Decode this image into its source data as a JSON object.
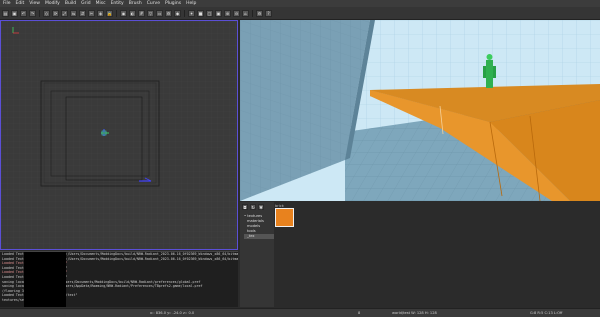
{
  "menu": [
    "File",
    "Edit",
    "View",
    "Modify",
    "Build",
    "Grid",
    "Misc",
    "Entity",
    "Brush",
    "Curve",
    "Plugins",
    "Help"
  ],
  "toolbar_icons": [
    "open-icon",
    "save-icon",
    "undo-icon",
    "redo-icon",
    "select-icon",
    "rotate-icon",
    "scale-icon",
    "flip-x-icon",
    "flip-y-icon",
    "clipper-icon",
    "csg-icon",
    "texture-lock-icon",
    "camera-icon",
    "patch-icon",
    "grid-icon",
    "filter-icon",
    "region-icon",
    "plugin-icon",
    "entity-icon",
    "light-icon",
    "brush-icon",
    "cube-icon",
    "hollow-icon",
    "merge-icon",
    "subtract-icon",
    "make-room-icon",
    "preferences-icon",
    "help-icon"
  ],
  "texture_browser": {
    "tree": [
      {
        "label": "• textures"
      },
      {
        "label": "materials"
      },
      {
        "label": "models"
      },
      {
        "label": "tools"
      },
      {
        "label": "_tex"
      }
    ],
    "thumb_label": "brick",
    "thumb_color": "#e8821e"
  },
  "console": [
    {
      "text": "Loaded Texture: \"textures/...\" C:/Users/Documents/ModdingDocs/build/NRW-Radiant_2023-06-16_0f02369_Windows_x86_64/bitmaps/notex.png\"",
      "warn": false
    },
    {
      "text": "Loaded Texture: \"textures/...\" C:/Users/Documents/ModdingDocs/build/NRW-Radiant_2023-06-16_0f02369_Windows_x86_64/bitmaps/notex.png\"",
      "warn": false
    },
    {
      "text": "Loaded Texture: \"textures/orange\"",
      "warn": true
    },
    {
      "text": "Loaded Texture: \"textures/orange\"",
      "warn": false
    },
    {
      "text": "Loaded Texture: \"textures/orange\"",
      "warn": true
    },
    {
      "text": "Loaded Texture: \"textures/orange\"",
      "warn": false
    },
    {
      "text": "saving local preferences to C:/Users/Documents/ModdingDocs/build/NRW-Radiant/preferences/global.pref",
      "warn": false
    },
    {
      "text": "saving local preferences to C:/Users/AppData/Roaming/NRW-Radiant/Preferences/TBprefs2-game/local.pref",
      "warn": false
    },
    {
      "text": "(flooring 3 shaders)",
      "warn": false
    },
    {
      "text": "Loaded Texture: \"textures/orient/test\"",
      "warn": false
    },
    {
      "text": "textures/selected/selected",
      "warn": false
    }
  ],
  "status": {
    "coords": "x:: 836.0  y:: -24.0  z:: 0.0",
    "grid": "8",
    "right": "world/test W: 128 H: 128",
    "version": "G:8  R:5  C:13  L:Off"
  }
}
